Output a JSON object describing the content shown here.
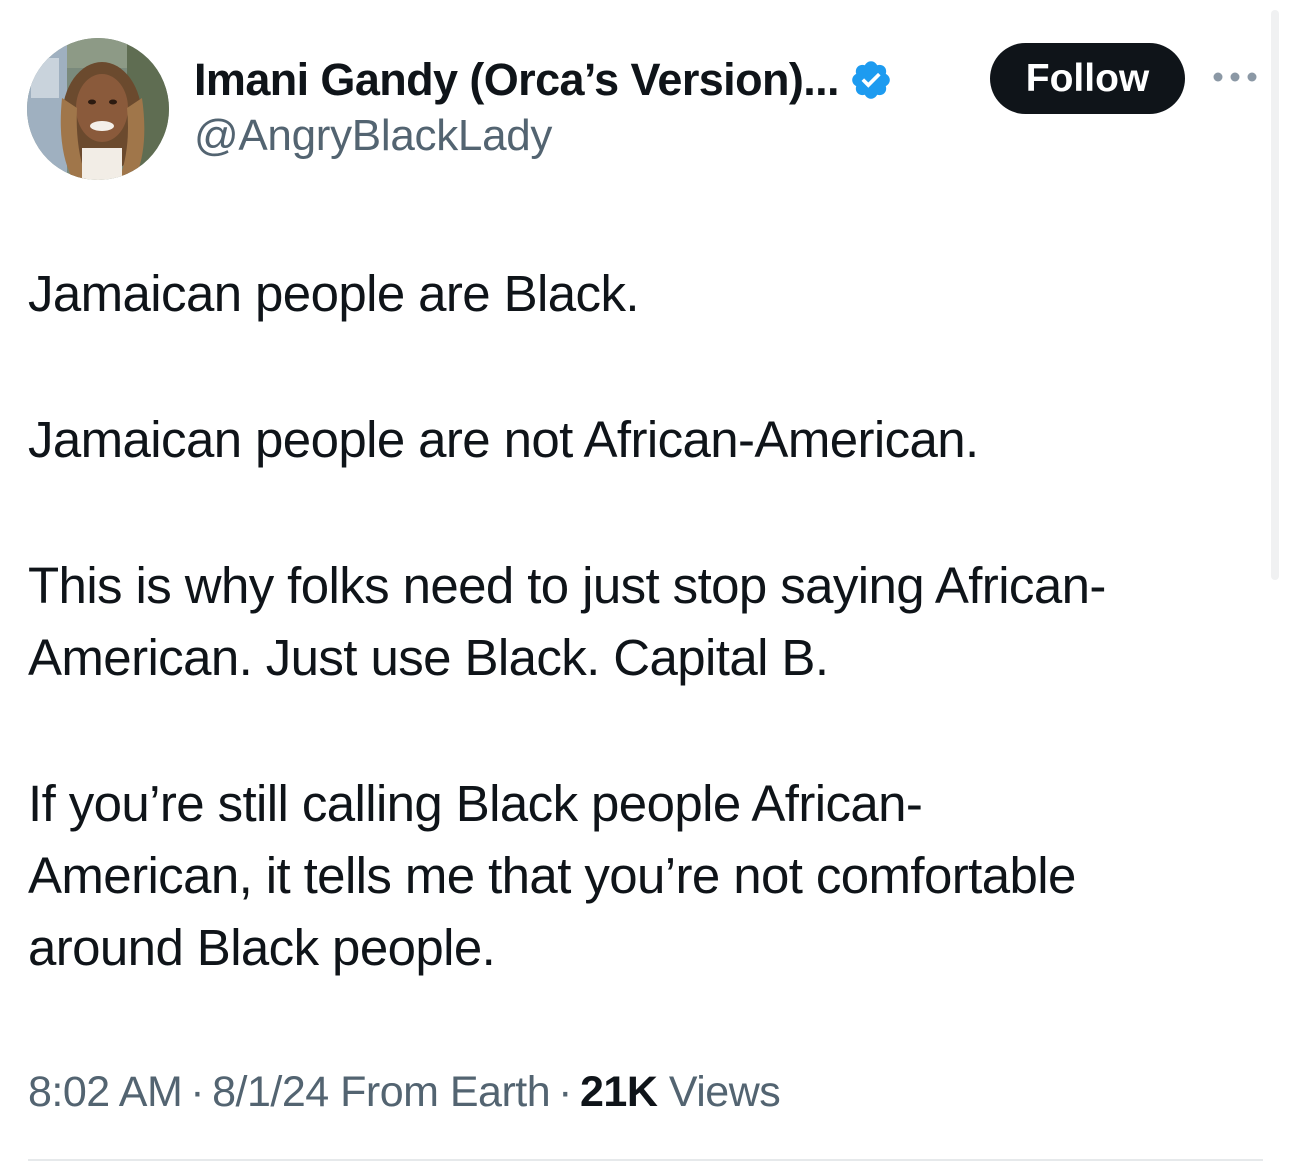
{
  "author": {
    "display_name": "Imani Gandy (Orca’s Version)...",
    "handle": "@AngryBlackLady",
    "verified": true,
    "avatar_icon": "profile-photo"
  },
  "actions": {
    "follow_label": "Follow",
    "more_icon": "ellipsis-icon"
  },
  "tweet": {
    "paragraphs": [
      "Jamaican people are Black.",
      "Jamaican people are not African-American.",
      "This is why folks need to just stop saying African-\nAmerican. Just use Black. Capital B.",
      "If you’re still calling Black people African-\nAmerican, it tells me that you’re not comfortable\naround Black people."
    ]
  },
  "meta": {
    "time": "8:02 AM",
    "date": "8/1/24",
    "source": "From Earth",
    "separator": "·",
    "views_count": "21K",
    "views_label": "Views"
  },
  "colors": {
    "text_primary": "#0f1419",
    "text_secondary": "#536471",
    "verified_blue": "#1d9bf0",
    "follow_bg": "#0f1419"
  }
}
